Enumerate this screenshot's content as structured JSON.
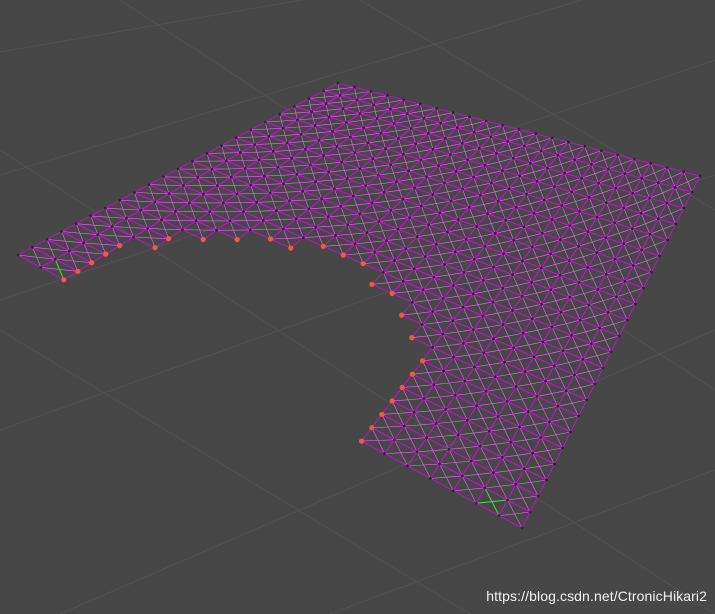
{
  "watermark": "https://blog.csdn.net/CtronicHikari2",
  "scene": {
    "object": "cloth-mesh",
    "colors": {
      "background": "#474747",
      "grid_line": "#525252",
      "wire": "#e000f0",
      "wire_light": "#f060ff",
      "edge_vertex": "#f25a3a",
      "interior_vertex": "#2a2a2a",
      "selected_edge": "#3ddc3d"
    }
  }
}
